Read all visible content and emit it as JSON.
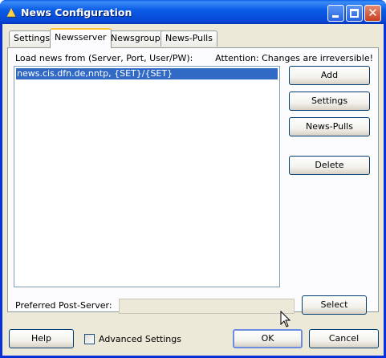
{
  "window": {
    "title": "News Configuration",
    "icon": "warning-triangle-icon"
  },
  "tabs": [
    {
      "label": "Settings",
      "active": false
    },
    {
      "label": "Newsserver",
      "active": true
    },
    {
      "label": "Newsgroups",
      "active": false
    },
    {
      "label": "News-Pulls",
      "active": false
    }
  ],
  "panel": {
    "list_label": "Load news from (Server, Port, User/PW):",
    "attention": "Attention: Changes are irreversible!",
    "servers": [
      "news.cis.dfn.de,nntp, {SET}/{SET}"
    ],
    "selected_index": 0,
    "buttons": {
      "add": "Add",
      "settings": "Settings",
      "news_pulls": "News-Pulls",
      "delete": "Delete"
    }
  },
  "post_server": {
    "label": "Preferred Post-Server:",
    "value": "",
    "select_label": "Select"
  },
  "footer": {
    "help": "Help",
    "advanced_settings": "Advanced Settings",
    "advanced_checked": false,
    "ok": "OK",
    "cancel": "Cancel"
  },
  "colors": {
    "titlebar": "#0b5ee6",
    "selection": "#316ac5",
    "dialog_bg": "#ece9d8"
  }
}
